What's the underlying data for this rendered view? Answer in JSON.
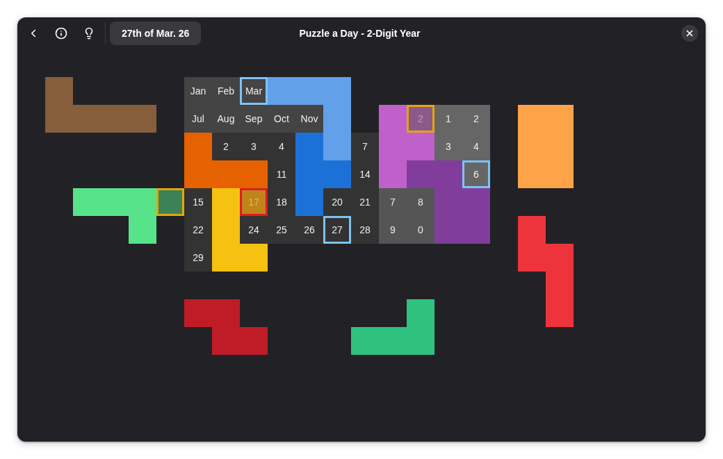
{
  "header": {
    "date_button": "27th of Mar. 26",
    "title": "Puzzle a Day - 2-Digit Year"
  },
  "canvas": {
    "rows": [
      {
        "cells": [
          {
            "kind": "piece",
            "color": "#865e3c"
          },
          {
            "kind": "gap"
          },
          {
            "kind": "gap"
          },
          {
            "kind": "gap"
          },
          {
            "kind": "gap"
          },
          {
            "kind": "slot",
            "label": "Jan",
            "color": "#444444",
            "selected": false,
            "covered": false
          },
          {
            "kind": "slot",
            "label": "Feb",
            "color": "#444444",
            "selected": false,
            "covered": false
          },
          {
            "kind": "slot",
            "label": "Mar",
            "color": "#444444",
            "selected": true,
            "covered": false
          },
          {
            "kind": "piece",
            "color": "#62a0ea"
          },
          {
            "kind": "piece",
            "color": "#62a0ea"
          },
          {
            "kind": "piece",
            "color": "#62a0ea"
          },
          {
            "kind": "gap"
          },
          {
            "kind": "gap"
          },
          {
            "kind": "gap"
          },
          {
            "kind": "gap"
          },
          {
            "kind": "gap"
          },
          {
            "kind": "gap"
          },
          {
            "kind": "gap"
          },
          {
            "kind": "gap"
          }
        ]
      },
      {
        "cells": [
          {
            "kind": "piece",
            "color": "#865e3c"
          },
          {
            "kind": "piece",
            "color": "#865e3c"
          },
          {
            "kind": "piece",
            "color": "#865e3c"
          },
          {
            "kind": "piece",
            "color": "#865e3c"
          },
          {
            "kind": "gap"
          },
          {
            "kind": "slot",
            "label": "Jul",
            "color": "#444444",
            "selected": false,
            "covered": false
          },
          {
            "kind": "slot",
            "label": "Aug",
            "color": "#444444",
            "selected": false,
            "covered": false
          },
          {
            "kind": "slot",
            "label": "Sep",
            "color": "#444444",
            "selected": false,
            "covered": false
          },
          {
            "kind": "slot",
            "label": "Oct",
            "color": "#444444",
            "selected": false,
            "covered": false
          },
          {
            "kind": "slot",
            "label": "Nov",
            "color": "#444444",
            "selected": false,
            "covered": false
          },
          {
            "kind": "piece",
            "color": "#62a0ea"
          },
          {
            "kind": "gap"
          },
          {
            "kind": "piece",
            "color": "#c061cb"
          },
          {
            "kind": "slot",
            "label": "2",
            "color": "#8b5a8a",
            "selected": false,
            "covered": true,
            "warning": true
          },
          {
            "kind": "slot",
            "label": "1",
            "color": "#666666",
            "selected": false,
            "covered": false
          },
          {
            "kind": "slot",
            "label": "2",
            "color": "#666666",
            "selected": false,
            "covered": false
          },
          {
            "kind": "gap"
          },
          {
            "kind": "piece",
            "color": "#ffa348"
          },
          {
            "kind": "piece",
            "color": "#ffa348"
          }
        ]
      },
      {
        "cells": [
          {
            "kind": "gap"
          },
          {
            "kind": "gap"
          },
          {
            "kind": "gap"
          },
          {
            "kind": "gap"
          },
          {
            "kind": "gap"
          },
          {
            "kind": "piece",
            "color": "#e66100"
          },
          {
            "kind": "slot",
            "label": "2",
            "color": "#333333",
            "selected": false,
            "covered": false
          },
          {
            "kind": "slot",
            "label": "3",
            "color": "#333333",
            "selected": false,
            "covered": false
          },
          {
            "kind": "slot",
            "label": "4",
            "color": "#333333",
            "selected": false,
            "covered": false
          },
          {
            "kind": "piece",
            "color": "#1c71d8"
          },
          {
            "kind": "piece",
            "color": "#62a0ea"
          },
          {
            "kind": "slot",
            "label": "7",
            "color": "#333333",
            "selected": false,
            "covered": false
          },
          {
            "kind": "piece",
            "color": "#c061cb"
          },
          {
            "kind": "piece",
            "color": "#c061cb"
          },
          {
            "kind": "slot",
            "label": "3",
            "color": "#666666",
            "selected": false,
            "covered": false
          },
          {
            "kind": "slot",
            "label": "4",
            "color": "#666666",
            "selected": false,
            "covered": false
          },
          {
            "kind": "gap"
          },
          {
            "kind": "piece",
            "color": "#ffa348"
          },
          {
            "kind": "piece",
            "color": "#ffa348"
          }
        ]
      },
      {
        "cells": [
          {
            "kind": "gap"
          },
          {
            "kind": "gap"
          },
          {
            "kind": "gap"
          },
          {
            "kind": "gap"
          },
          {
            "kind": "gap"
          },
          {
            "kind": "piece",
            "color": "#e66100"
          },
          {
            "kind": "piece",
            "color": "#e66100"
          },
          {
            "kind": "piece",
            "color": "#e66100"
          },
          {
            "kind": "slot",
            "label": "11",
            "color": "#333333",
            "selected": false,
            "covered": false
          },
          {
            "kind": "piece",
            "color": "#1c71d8"
          },
          {
            "kind": "piece",
            "color": "#1c71d8"
          },
          {
            "kind": "slot",
            "label": "14",
            "color": "#333333",
            "selected": false,
            "covered": false
          },
          {
            "kind": "piece",
            "color": "#c061cb"
          },
          {
            "kind": "piece",
            "color": "#813d9c"
          },
          {
            "kind": "piece",
            "color": "#813d9c"
          },
          {
            "kind": "slot",
            "label": "6",
            "color": "#666666",
            "selected": true,
            "covered": false
          },
          {
            "kind": "gap"
          },
          {
            "kind": "piece",
            "color": "#ffa348"
          },
          {
            "kind": "piece",
            "color": "#ffa348"
          }
        ]
      },
      {
        "cells": [
          {
            "kind": "gap"
          },
          {
            "kind": "piece",
            "color": "#57e389"
          },
          {
            "kind": "piece",
            "color": "#57e389"
          },
          {
            "kind": "piece",
            "color": "#57e389"
          },
          {
            "kind": "piece",
            "color": "#3c8257",
            "warning": true
          },
          {
            "kind": "slot",
            "label": "15",
            "color": "#333333",
            "selected": false,
            "covered": false
          },
          {
            "kind": "piece",
            "color": "#f5c211"
          },
          {
            "kind": "slot",
            "label": "17",
            "color": "#c0841a",
            "selected": false,
            "covered": true,
            "error": true
          },
          {
            "kind": "slot",
            "label": "18",
            "color": "#333333",
            "selected": false,
            "covered": false
          },
          {
            "kind": "piece",
            "color": "#1c71d8"
          },
          {
            "kind": "slot",
            "label": "20",
            "color": "#333333",
            "selected": false,
            "covered": false
          },
          {
            "kind": "slot",
            "label": "21",
            "color": "#333333",
            "selected": false,
            "covered": false
          },
          {
            "kind": "slot",
            "label": "7",
            "color": "#555555",
            "selected": false,
            "covered": false
          },
          {
            "kind": "slot",
            "label": "8",
            "color": "#555555",
            "selected": false,
            "covered": false
          },
          {
            "kind": "piece",
            "color": "#813d9c"
          },
          {
            "kind": "piece",
            "color": "#813d9c"
          },
          {
            "kind": "gap"
          },
          {
            "kind": "gap"
          },
          {
            "kind": "gap"
          }
        ]
      },
      {
        "cells": [
          {
            "kind": "gap"
          },
          {
            "kind": "gap"
          },
          {
            "kind": "gap"
          },
          {
            "kind": "piece",
            "color": "#57e389"
          },
          {
            "kind": "gap"
          },
          {
            "kind": "slot",
            "label": "22",
            "color": "#333333",
            "selected": false,
            "covered": false
          },
          {
            "kind": "piece",
            "color": "#f5c211"
          },
          {
            "kind": "slot",
            "label": "24",
            "color": "#333333",
            "selected": false,
            "covered": false
          },
          {
            "kind": "slot",
            "label": "25",
            "color": "#333333",
            "selected": false,
            "covered": false
          },
          {
            "kind": "slot",
            "label": "26",
            "color": "#333333",
            "selected": false,
            "covered": false
          },
          {
            "kind": "slot",
            "label": "27",
            "color": "#333333",
            "selected": true,
            "covered": false
          },
          {
            "kind": "slot",
            "label": "28",
            "color": "#333333",
            "selected": false,
            "covered": false
          },
          {
            "kind": "slot",
            "label": "9",
            "color": "#555555",
            "selected": false,
            "covered": false
          },
          {
            "kind": "slot",
            "label": "0",
            "color": "#555555",
            "selected": false,
            "covered": false
          },
          {
            "kind": "piece",
            "color": "#813d9c"
          },
          {
            "kind": "piece",
            "color": "#813d9c"
          },
          {
            "kind": "gap"
          },
          {
            "kind": "piece",
            "color": "#ed333b"
          },
          {
            "kind": "gap"
          }
        ]
      },
      {
        "cells": [
          {
            "kind": "gap"
          },
          {
            "kind": "gap"
          },
          {
            "kind": "gap"
          },
          {
            "kind": "gap"
          },
          {
            "kind": "gap"
          },
          {
            "kind": "slot",
            "label": "29",
            "color": "#333333",
            "selected": false,
            "covered": false
          },
          {
            "kind": "piece",
            "color": "#f5c211"
          },
          {
            "kind": "piece",
            "color": "#f5c211"
          },
          {
            "kind": "gap"
          },
          {
            "kind": "gap"
          },
          {
            "kind": "gap"
          },
          {
            "kind": "gap"
          },
          {
            "kind": "gap"
          },
          {
            "kind": "gap"
          },
          {
            "kind": "gap"
          },
          {
            "kind": "gap"
          },
          {
            "kind": "gap"
          },
          {
            "kind": "piece",
            "color": "#ed333b"
          },
          {
            "kind": "piece",
            "color": "#ed333b"
          }
        ]
      },
      {
        "cells": [
          {
            "kind": "gap"
          },
          {
            "kind": "gap"
          },
          {
            "kind": "gap"
          },
          {
            "kind": "gap"
          },
          {
            "kind": "gap"
          },
          {
            "kind": "gap"
          },
          {
            "kind": "gap"
          },
          {
            "kind": "gap"
          },
          {
            "kind": "gap"
          },
          {
            "kind": "gap"
          },
          {
            "kind": "gap"
          },
          {
            "kind": "gap"
          },
          {
            "kind": "gap"
          },
          {
            "kind": "gap"
          },
          {
            "kind": "gap"
          },
          {
            "kind": "gap"
          },
          {
            "kind": "gap"
          },
          {
            "kind": "gap"
          },
          {
            "kind": "piece",
            "color": "#ed333b"
          }
        ]
      },
      {
        "cells": [
          {
            "kind": "gap"
          },
          {
            "kind": "gap"
          },
          {
            "kind": "gap"
          },
          {
            "kind": "gap"
          },
          {
            "kind": "gap"
          },
          {
            "kind": "piece",
            "color": "#c01c28"
          },
          {
            "kind": "piece",
            "color": "#c01c28"
          },
          {
            "kind": "gap"
          },
          {
            "kind": "gap"
          },
          {
            "kind": "gap"
          },
          {
            "kind": "gap"
          },
          {
            "kind": "gap"
          },
          {
            "kind": "gap"
          },
          {
            "kind": "piece",
            "color": "#2ec27e"
          },
          {
            "kind": "gap"
          },
          {
            "kind": "gap"
          },
          {
            "kind": "gap"
          },
          {
            "kind": "gap"
          },
          {
            "kind": "piece",
            "color": "#ed333b"
          }
        ]
      },
      {
        "cells": [
          {
            "kind": "gap"
          },
          {
            "kind": "gap"
          },
          {
            "kind": "gap"
          },
          {
            "kind": "gap"
          },
          {
            "kind": "gap"
          },
          {
            "kind": "gap"
          },
          {
            "kind": "piece",
            "color": "#c01c28"
          },
          {
            "kind": "piece",
            "color": "#c01c28"
          },
          {
            "kind": "gap"
          },
          {
            "kind": "gap"
          },
          {
            "kind": "gap"
          },
          {
            "kind": "piece",
            "color": "#2ec27e"
          },
          {
            "kind": "piece",
            "color": "#2ec27e"
          },
          {
            "kind": "piece",
            "color": "#2ec27e"
          },
          {
            "kind": "gap"
          },
          {
            "kind": "gap"
          },
          {
            "kind": "gap"
          },
          {
            "kind": "gap"
          },
          {
            "kind": "gap"
          }
        ]
      }
    ]
  }
}
